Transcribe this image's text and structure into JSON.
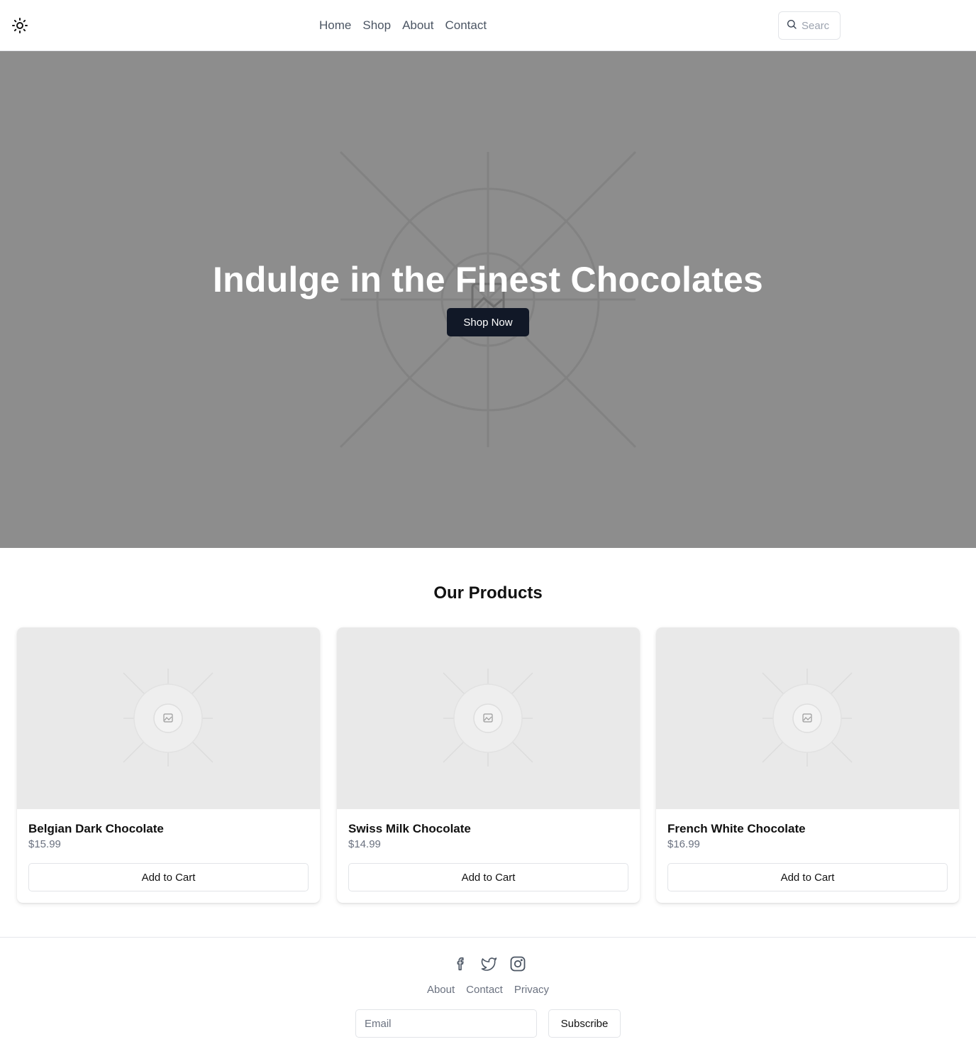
{
  "header": {
    "theme_icon": "sun-icon",
    "nav": [
      {
        "label": "Home"
      },
      {
        "label": "Shop"
      },
      {
        "label": "About"
      },
      {
        "label": "Contact"
      }
    ],
    "search": {
      "placeholder": "Search",
      "icon": "search-icon"
    }
  },
  "hero": {
    "title": "Indulge in the Finest Chocolates",
    "button": "Shop Now",
    "background_color": "#8d8d8d",
    "image": "image-placeholder-icon"
  },
  "products": {
    "title": "Our Products",
    "items": [
      {
        "name": "Belgian Dark Chocolate",
        "price": "$15.99",
        "button": "Add to Cart"
      },
      {
        "name": "Swiss Milk Chocolate",
        "price": "$14.99",
        "button": "Add to Cart"
      },
      {
        "name": "French White Chocolate",
        "price": "$16.99",
        "button": "Add to Cart"
      }
    ]
  },
  "footer": {
    "socials": [
      "facebook-icon",
      "twitter-icon",
      "instagram-icon"
    ],
    "links": [
      {
        "label": "About"
      },
      {
        "label": "Contact"
      },
      {
        "label": "Privacy"
      }
    ],
    "email_placeholder": "Email",
    "subscribe": "Subscribe"
  },
  "colors": {
    "primary_button": "#111827",
    "muted_text": "#6b7280",
    "placeholder_bg": "#e9e9e9"
  }
}
